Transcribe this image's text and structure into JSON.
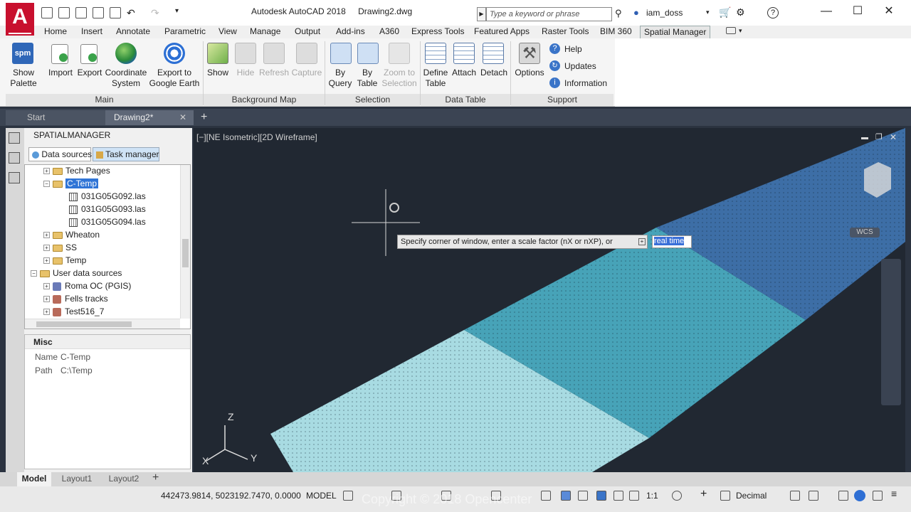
{
  "titlebar": {
    "app_title": "Autodesk AutoCAD 2018",
    "doc_title": "Drawing2.dwg",
    "search_placeholder": "Type a keyword or phrase",
    "user": "iam_doss"
  },
  "ribbon_tabs": [
    "Home",
    "Insert",
    "Annotate",
    "Parametric",
    "View",
    "Manage",
    "Output",
    "Add-ins",
    "A360",
    "Express Tools",
    "Featured Apps",
    "Raster Tools",
    "BIM 360",
    "Spatial Manager"
  ],
  "ribbon": {
    "main": {
      "title": "Main",
      "show_palette": "Show\nPalette",
      "import": "Import",
      "export": "Export",
      "coordinate_system": "Coordinate\nSystem",
      "export_google_earth": "Export to\nGoogle Earth"
    },
    "background_map": {
      "title": "Background Map",
      "show": "Show",
      "hide": "Hide",
      "refresh": "Refresh",
      "capture": "Capture"
    },
    "selection": {
      "title": "Selection",
      "by_query": "By\nQuery",
      "by_table": "By\nTable",
      "zoom_to_selection": "Zoom to\nSelection"
    },
    "data_table": {
      "title": "Data Table",
      "define_table": "Define\nTable",
      "attach": "Attach",
      "detach": "Detach"
    },
    "support": {
      "title": "Support",
      "options": "Options",
      "help": "Help",
      "updates": "Updates",
      "information": "Information"
    }
  },
  "doc_tabs": {
    "start": "Start",
    "drawing": "Drawing2*"
  },
  "palette": {
    "title": "SPATIALMANAGER",
    "tab_data_sources": "Data sources",
    "tab_task_manager": "Task manager",
    "tree": [
      {
        "label": "Tech Pages",
        "kind": "folder"
      },
      {
        "label": "C-Temp",
        "kind": "folder"
      },
      {
        "label": "031G05G092.las",
        "kind": "file"
      },
      {
        "label": "031G05G093.las",
        "kind": "file"
      },
      {
        "label": "031G05G094.las",
        "kind": "file"
      },
      {
        "label": "Wheaton",
        "kind": "folder"
      },
      {
        "label": "SS",
        "kind": "folder"
      },
      {
        "label": "Temp",
        "kind": "folder"
      },
      {
        "label": "User data sources",
        "kind": "folder"
      },
      {
        "label": "Roma OC (PGIS)",
        "kind": "source"
      },
      {
        "label": "Fells tracks",
        "kind": "source"
      },
      {
        "label": "Test516_7",
        "kind": "source"
      }
    ],
    "misc": {
      "header": "Misc",
      "name_label": "Name",
      "name_value": "C-Temp",
      "path_label": "Path",
      "path_value": "C:\\Temp"
    }
  },
  "viewport": {
    "label": "[−][NE Isometric][2D Wireframe]",
    "cmd_prompt": "Specify corner of window, enter a scale factor (nX or nXP), or",
    "cmd_input": "real time",
    "wcs": "WCS",
    "axis_x": "X",
    "axis_y": "Y",
    "axis_z": "Z"
  },
  "layout_tabs": [
    "Model",
    "Layout1",
    "Layout2"
  ],
  "status": {
    "coords": "442473.9814, 5023192.7470, 0.0000",
    "space": "MODEL",
    "scale": "1:1",
    "units": "Decimal",
    "watermark": "Copyright © 2018 Opencenter"
  },
  "colors": {
    "pointcloud_light": "#9fd8e0",
    "pointcloud_mid": "#3d9ab0",
    "pointcloud_dark": "#3a6aa0",
    "viewport_bg": "#212832",
    "logo_red": "#c8102e"
  }
}
